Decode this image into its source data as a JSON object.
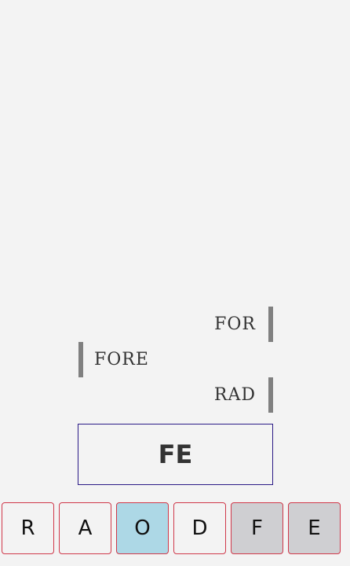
{
  "history": [
    {
      "word": "FOR",
      "side": "right"
    },
    {
      "word": "FORE",
      "side": "left"
    },
    {
      "word": "RAD",
      "side": "right"
    }
  ],
  "current_word": "FE",
  "tiles": [
    {
      "letter": "R",
      "state": "default"
    },
    {
      "letter": "A",
      "state": "default"
    },
    {
      "letter": "O",
      "state": "selected"
    },
    {
      "letter": "D",
      "state": "default"
    },
    {
      "letter": "F",
      "state": "used"
    },
    {
      "letter": "E",
      "state": "used"
    }
  ],
  "colors": {
    "background": "#f3f3f3",
    "tile_border": "#d0384a",
    "tile_selected": "#add8e6",
    "tile_used": "#cfcfd2",
    "word_box_border": "#2b1a86",
    "history_bar": "#808080"
  }
}
